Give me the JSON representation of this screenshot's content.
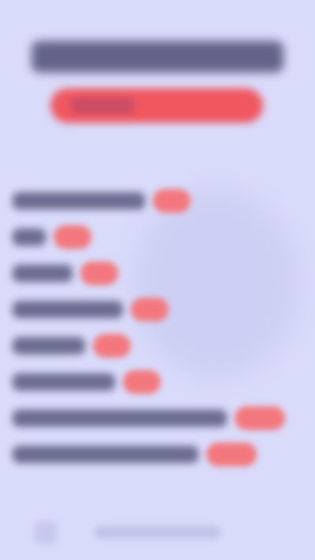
{
  "colors": {
    "background": "#d9dbfa",
    "title_block": "#55577d",
    "accent_pill": "#f0575f",
    "badge": "#f3787d",
    "label_block": "#57597e"
  },
  "items": [
    {
      "badge_color": "#f3787d"
    },
    {
      "badge_color": "#f3787d"
    },
    {
      "badge_color": "#f3787d"
    },
    {
      "badge_color": "#f3787d"
    },
    {
      "badge_color": "#f3787d"
    },
    {
      "badge_color": "#f3787d"
    },
    {
      "badge_color": "#f3787d"
    },
    {
      "badge_color": "#f3787d"
    }
  ]
}
